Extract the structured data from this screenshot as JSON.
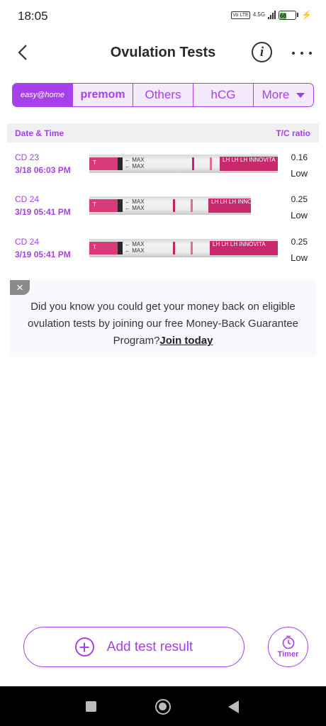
{
  "status_bar": {
    "time": "18:05",
    "network": "4.5G",
    "volte": "Vo LTE",
    "battery": "68"
  },
  "header": {
    "title": "Ovulation Tests",
    "back_icon": "chevron-left-icon",
    "info_icon": "info-icon",
    "more_icon": "more-horizontal-icon"
  },
  "tabs": {
    "easy_home": "easy@home",
    "premom": "premom",
    "others": "Others",
    "hcg": "hCG",
    "more": "More"
  },
  "table": {
    "col_date": "Date & Time",
    "col_ratio": "T/C ratio",
    "rows": [
      {
        "cd": "CD 23",
        "datetime": "3/18   06:03 PM",
        "ratio": "0.16",
        "level": "Low"
      },
      {
        "cd": "CD 24",
        "datetime": "3/19   05:41 PM",
        "ratio": "0.25",
        "level": "Low"
      },
      {
        "cd": "CD 24",
        "datetime": "3/19   05:41 PM",
        "ratio": "0.25",
        "level": "Low"
      }
    ],
    "strip_label": "MAX",
    "strip_end": "LH LH LH INNOVITA"
  },
  "promo": {
    "text": "Did you know you could get your money back on eligible ovulation tests by joining our free Money-Back Guarantee Program?",
    "link": "Join today"
  },
  "actions": {
    "add_label": "Add test result",
    "timer_label": "Timer"
  },
  "colors": {
    "accent": "#a640e8",
    "strip_pink": "#d93a7a"
  }
}
